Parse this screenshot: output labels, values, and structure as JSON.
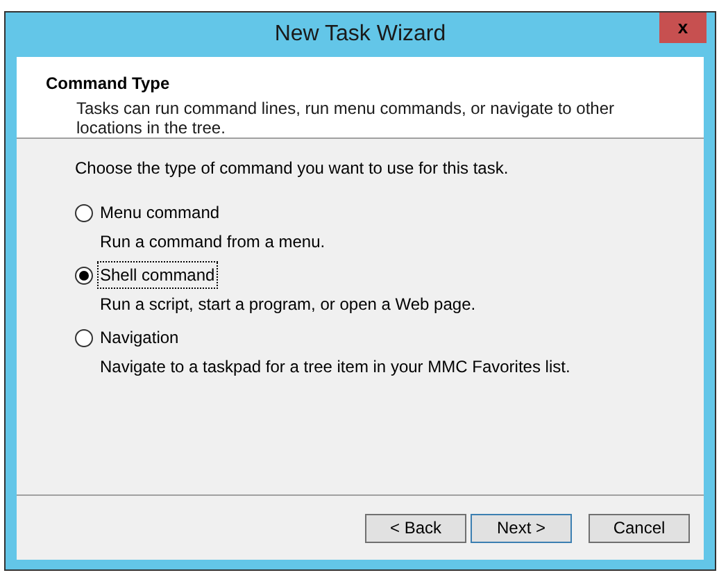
{
  "window": {
    "title": "New Task Wizard",
    "close": "x"
  },
  "header": {
    "title": "Command Type",
    "description": "Tasks can run command lines, run menu commands, or navigate to other locations in the tree."
  },
  "prompt": "Choose the type of command you want to use for this task.",
  "options": [
    {
      "label": "Menu command",
      "description": "Run a command from a menu.",
      "selected": false
    },
    {
      "label": "Shell command",
      "description": "Run a script, start a program, or open a Web page.",
      "selected": true
    },
    {
      "label": "Navigation",
      "description": "Navigate to a taskpad for a tree item in your MMC Favorites list.",
      "selected": false
    }
  ],
  "buttons": [
    {
      "label": "< Back",
      "default": false
    },
    {
      "label": "Next >",
      "default": true
    },
    {
      "label": "Cancel",
      "default": false
    }
  ]
}
